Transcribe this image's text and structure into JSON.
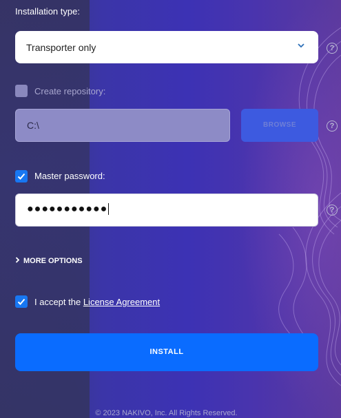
{
  "installation_type": {
    "label": "Installation type:",
    "selected": "Transporter only"
  },
  "create_repository": {
    "label": "Create repository:",
    "checked": false,
    "path_value": "C:\\",
    "browse_label": "BROWSE"
  },
  "master_password": {
    "label": "Master password:",
    "checked": true,
    "masked_value": "●●●●●●●●●●●"
  },
  "more_options": {
    "label": "MORE OPTIONS"
  },
  "license": {
    "prefix": "I accept the ",
    "link_text": "License Agreement",
    "checked": true
  },
  "install_button": {
    "label": "INSTALL"
  },
  "footer": {
    "text": "© 2023 NAKIVO, Inc. All Rights Reserved."
  },
  "help_icon_glyph": "?",
  "colors": {
    "accent": "#0a6cff",
    "checkbox_on": "#1877f2",
    "disabled_input": "#8d8bc6"
  }
}
